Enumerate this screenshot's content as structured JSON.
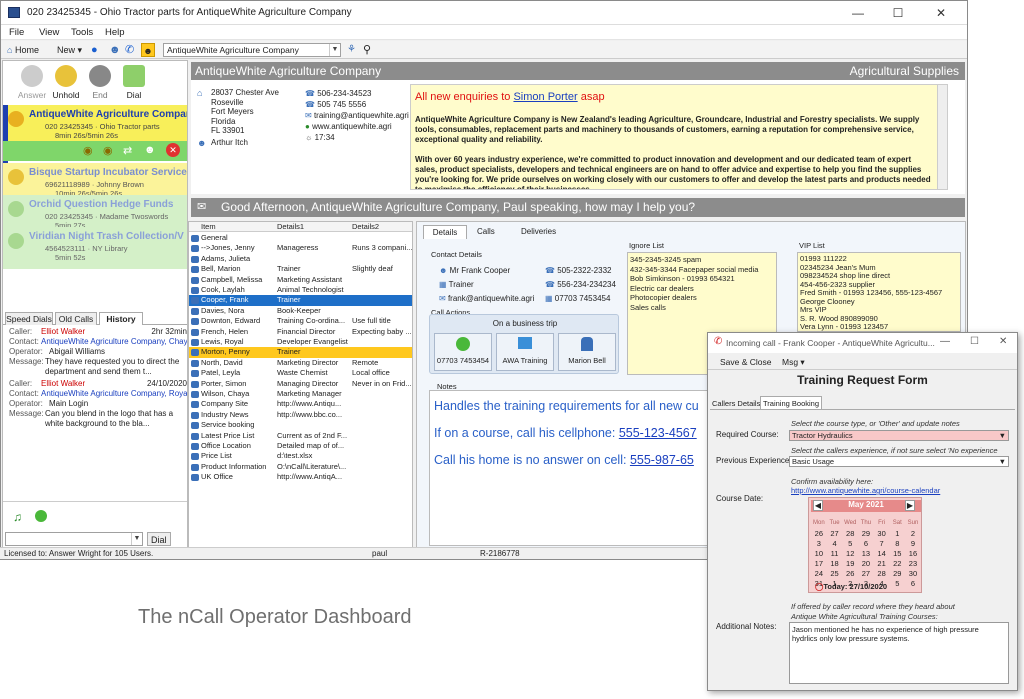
{
  "window": {
    "title": "020 23425345 - Ohio Tractor parts for AntiqueWhite Agriculture Company"
  },
  "menu": {
    "file": "File",
    "view": "View",
    "tools": "Tools",
    "help": "Help"
  },
  "toolbar": {
    "home": "Home",
    "new": "New",
    "company_select": "AntiqueWhite Agriculture Company"
  },
  "call_controls": {
    "answer": "Answer",
    "unhold": "Unhold",
    "end": "End",
    "dial": "Dial"
  },
  "calls": [
    {
      "name": "AntiqueWhite Agriculture Compar",
      "sub": "020 23425345 · Ohio Tractor parts",
      "time": "8min 26s/5min 26s"
    },
    {
      "name": "Bisque Startup Incubator Service",
      "sub": "69621118989 · Johnny Brown",
      "time": "10min 26s/5min 26s"
    },
    {
      "name": "Orchid Question Hedge Funds",
      "sub": "020 23425345 · Madame Twoswords",
      "time": "5min 27s"
    },
    {
      "name": "Viridian Night Trash Collection/V",
      "sub": "4564523111 · NY Library",
      "time": "5min 52s"
    }
  ],
  "left_tabs": {
    "speed_dials": "Speed Dials",
    "old_calls": "Old Calls",
    "history": "History"
  },
  "history": [
    {
      "caller_k": "Caller:",
      "caller": "Elliot Walker",
      "date": "2hr 32min",
      "contact_k": "Contact:",
      "contact": "AntiqueWhite Agriculture Company, Chaya",
      "operator_k": "Operator:",
      "operator": "Abigail Williams",
      "message_k": "Message:",
      "message1": "They have requested you to direct the",
      "message2": "department and send them t..."
    },
    {
      "caller_k": "Caller:",
      "caller": "Elliot Walker",
      "date": "24/10/2020",
      "contact_k": "Contact:",
      "contact": "AntiqueWhite Agriculture Company, Royal",
      "operator_k": "Operator:",
      "operator": "Main Login",
      "message_k": "Message:",
      "message1": "Can you blend in the logo that has a",
      "message2": "white background to the bla..."
    }
  ],
  "dial_button": "Dial",
  "status": {
    "license": "Licensed to: Answer Wright for 105 Users.",
    "user": "paul",
    "code": "R-2186778"
  },
  "company": {
    "name": "AntiqueWhite Agriculture Company",
    "category": "Agricultural Supplies",
    "address": [
      "28037 Chester Ave",
      "Roseville",
      "Fort Meyers",
      "Florida",
      "FL 33901"
    ],
    "contact_person": "Arthur Itch",
    "phone1": "506-234-34523",
    "phone2": "505 745 5556",
    "email": "training@antiquewhite.agri",
    "website": "www.antiquewhite.agri",
    "local_time": "17:34"
  },
  "promo": {
    "alert_prefix": "All new enquiries to ",
    "alert_link": "Simon Porter",
    "alert_suffix": " asap",
    "para1": "AntiqueWhite Agriculture Company is New Zealand's leading Agriculture, Groundcare, Industrial and Forestry specialists. We supply tools, consumables, replacement parts and machinery to thousands of customers, earning a reputation for comprehensive service, exceptional quality and reliability.",
    "para2": "With over 60 years industry experience, we're committed to product innovation and development and our dedicated team of expert sales, product specialists, developers and technical engineers are on hand to offer advice and expertise to help you find the supplies you're looking for. We pride ourselves on working closely with our customers to offer and develop the latest parts and products needed to maximise the efficiency of their businesses."
  },
  "greeting": "Good Afternoon, AntiqueWhite Agriculture Company,  Paul  speaking, how may I help you?",
  "contact_table": {
    "headers": [
      "Item",
      "Details1",
      "Details2"
    ],
    "rows": [
      [
        "General",
        "",
        ""
      ],
      [
        "-->Jones, Jenny",
        "Manageress",
        "Runs 3 compani..."
      ],
      [
        "Adams, Julieta",
        "",
        ""
      ],
      [
        "Bell, Marion",
        "Trainer",
        "Slightly deaf"
      ],
      [
        "Campbell, Melissa",
        "Marketing Assistant",
        ""
      ],
      [
        "Cook, Laylah",
        "Animal Technologist",
        ""
      ],
      [
        "Cooper, Frank",
        "Trainer",
        ""
      ],
      [
        "Davies, Nora",
        "Book-Keeper",
        ""
      ],
      [
        "Downton, Edward",
        "Training Co-ordina...",
        "Use full title"
      ],
      [
        "French, Helen",
        "Financial Director",
        "Expecting baby ..."
      ],
      [
        "Lewis, Royal",
        "Developer Evangelist",
        ""
      ],
      [
        "Morton, Penny",
        "Trainer",
        ""
      ],
      [
        "North, David",
        "Marketing Director",
        "Remote"
      ],
      [
        "Patel, Leyla",
        "Waste Chemist",
        "Local office"
      ],
      [
        "Porter, Simon",
        "Managing Director",
        "Never in on Frid..."
      ],
      [
        "Wilson, Chaya",
        "Marketing Manager",
        ""
      ],
      [
        "Company Site",
        "http://www.Antiqu...",
        ""
      ],
      [
        "Industry News",
        "http://www.bbc.co...",
        ""
      ],
      [
        "Service booking",
        "",
        ""
      ],
      [
        "Latest Price List",
        "Current as of 2nd F...",
        ""
      ],
      [
        "Office Location",
        "Detailed map of of...",
        ""
      ],
      [
        "Price List",
        "d:\\test.xlsx",
        ""
      ],
      [
        "Product Information",
        "O:\\nCall\\Literature\\...",
        ""
      ],
      [
        "UK Office",
        "http://www.AntiqA...",
        ""
      ]
    ]
  },
  "detail_tabs": {
    "details": "Details",
    "calls": "Calls",
    "deliveries": "Deliveries"
  },
  "contact_details": {
    "heading": "Contact Details",
    "name": "Mr Frank Cooper",
    "role": "Trainer",
    "email": "frank@antiquewhite.agri",
    "phone1": "505-2322-2332",
    "phone2": "556-234-234234",
    "phone3": "07703 7453454"
  },
  "ignore_list": {
    "heading": "Ignore List",
    "items": [
      "345-2345-3245 spam",
      "432-345-3344 Facepaper social media",
      "Bob Simkinson - 01993 654321",
      "Electric car dealers",
      "Photocopier dealers",
      "Sales calls"
    ]
  },
  "vip_list": {
    "heading": "VIP List",
    "items": [
      "01993 111222",
      "02345234 Jean's Mum",
      "098234524 shop line direct",
      "454-456-2323 supplier",
      "Fred Smith - 01993 123456, 555-123-4567",
      "George Clooney",
      "Mrs VIP",
      "S. R. Wood 890899090",
      "Vera Lynn - 01993 123457"
    ]
  },
  "call_actions": {
    "heading": "Call Actions",
    "trip": "On a business trip",
    "btn1": "07703 7453454",
    "btn2": "AWA Training",
    "btn3": "Marion Bell"
  },
  "notes": {
    "heading": "Notes",
    "line1": "Handles the training requirements for all new cu",
    "line2_prefix": "If on a course, call his cellphone: ",
    "line2_link": "555-123-4567",
    "line3_prefix": "Call his home is no answer on cell: ",
    "line3_link": "555-987-65"
  },
  "popup": {
    "title": "Incoming call - Frank Cooper  -  AntiqueWhite Agricultu...",
    "save_close": "Save & Close",
    "msg": "Msg",
    "form_title": "Training Request Form",
    "tab1": "Callers Details",
    "tab2": "Training Booking",
    "hint1": "Select the course type, or 'Other' and update notes",
    "req_label": "Required Course:",
    "req_value": "Tractor Hydraulics",
    "hint2": "Select the callers experience, if not sure select 'No experience",
    "prev_label": "Previous Experience:",
    "prev_value": "Basic Usage",
    "confirm": "Confirm availability here:",
    "calendar_link": "http://www.antiquewhite.agri/course-calendar",
    "date_label": "Course Date:",
    "hint3a": "If offered by caller record where they heard about",
    "hint3b": "Antique White Agricultural Training Courses:",
    "notes_label": "Additional Notes:",
    "notes_text": "Jason mentioned he has no experience of high pressure hydrlics only low pressure systems."
  },
  "calendar": {
    "month": "May 2021",
    "weekdays": [
      "Mon",
      "Tue",
      "Wed",
      "Thu",
      "Fri",
      "Sat",
      "Sun"
    ],
    "rows": [
      [
        "26",
        "27",
        "28",
        "29",
        "30",
        "1",
        "2"
      ],
      [
        "3",
        "4",
        "5",
        "6",
        "7",
        "8",
        "9"
      ],
      [
        "10",
        "11",
        "12",
        "13",
        "14",
        "15",
        "16"
      ],
      [
        "17",
        "18",
        "19",
        "20",
        "21",
        "22",
        "23"
      ],
      [
        "24",
        "25",
        "26",
        "27",
        "28",
        "29",
        "30"
      ],
      [
        "31",
        "1",
        "2",
        "3",
        "4",
        "5",
        "6"
      ]
    ],
    "today": "Today: 27/10/2020"
  },
  "caption": "The nCall Operator Dashboard",
  "colors": {
    "selected_row": "#1e6fc8",
    "yellow_row": "#ffc81e",
    "active_call": "#f8ef5a",
    "call_green": "#9fe08a",
    "band": "#8c8c8c",
    "promo_bg": "#fffccc",
    "link": "#1a3fbf",
    "alert": "#e01010"
  }
}
